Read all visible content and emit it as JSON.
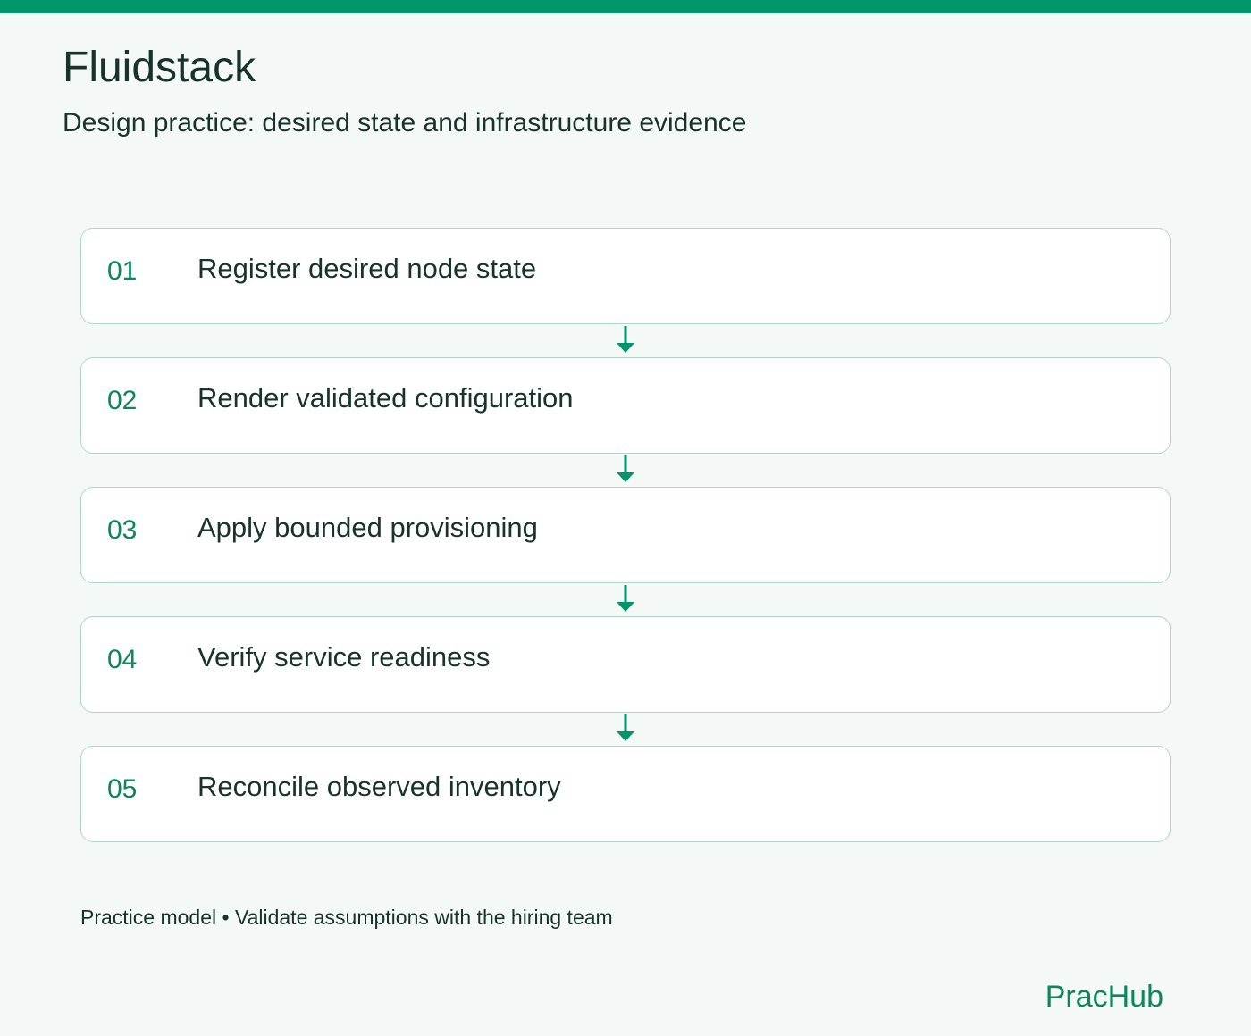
{
  "header": {
    "title": "Fluidstack",
    "subtitle": "Design practice: desired state and infrastructure evidence"
  },
  "steps": [
    {
      "number": "01",
      "label": "Register desired node state"
    },
    {
      "number": "02",
      "label": "Render validated configuration"
    },
    {
      "number": "03",
      "label": "Apply bounded provisioning"
    },
    {
      "number": "04",
      "label": "Verify service readiness"
    },
    {
      "number": "05",
      "label": "Reconcile observed inventory"
    }
  ],
  "footer": {
    "note": "Practice model • Validate assumptions with the hiring team",
    "brand": "PracHub"
  },
  "colors": {
    "accent": "#03956a",
    "text": "#17332b",
    "card_border": "#b3d6ca",
    "background": "#f4f8f6"
  }
}
